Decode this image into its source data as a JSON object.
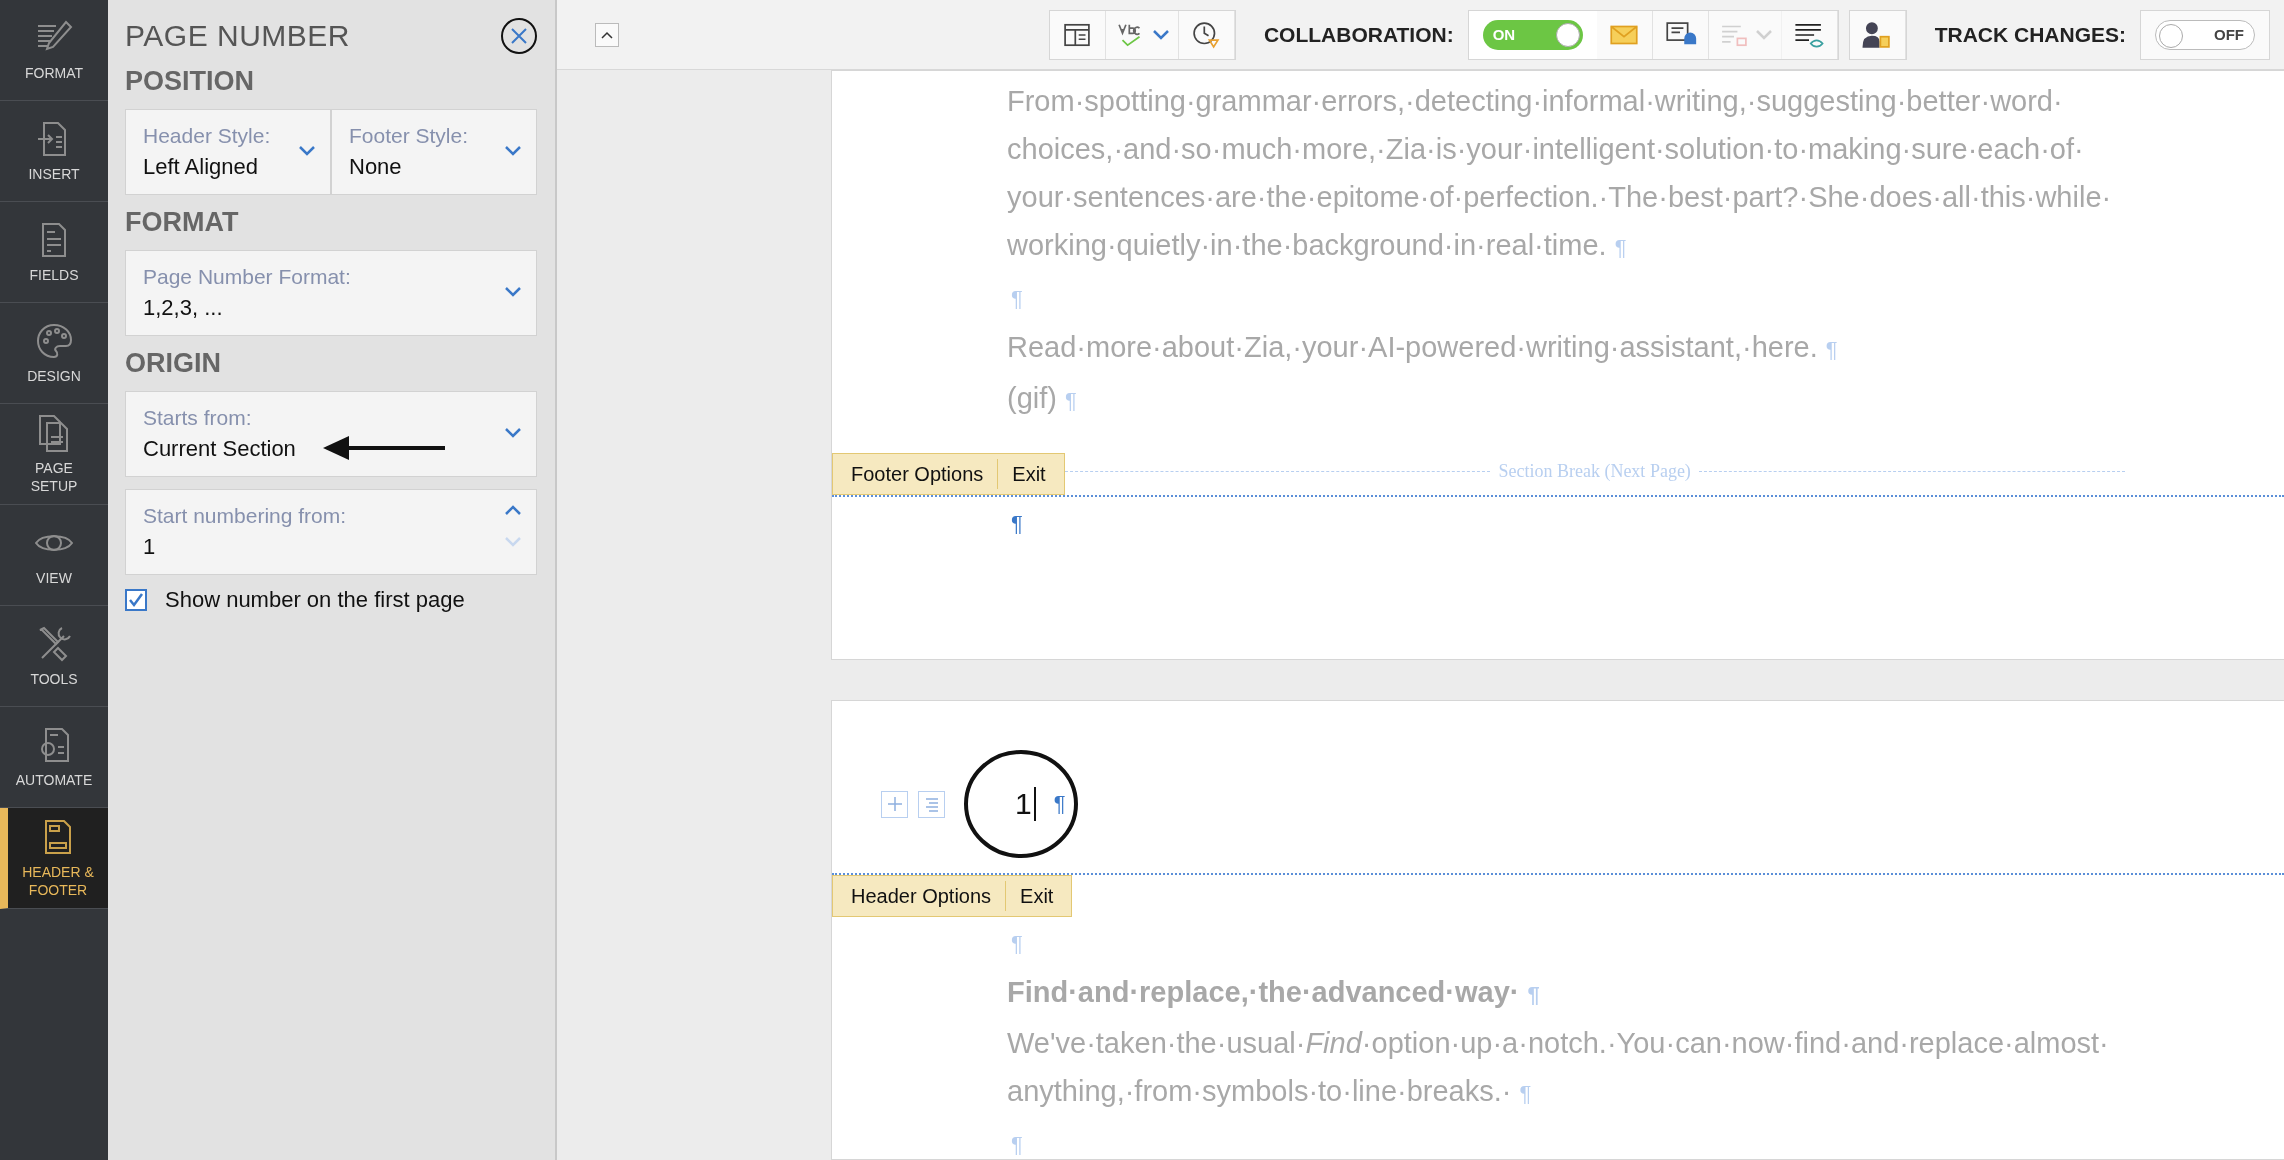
{
  "sidebar": {
    "items": [
      {
        "label": "FORMAT",
        "selected": false
      },
      {
        "label": "INSERT",
        "selected": false
      },
      {
        "label": "FIELDS",
        "selected": false
      },
      {
        "label": "DESIGN",
        "selected": false
      },
      {
        "label": "PAGE SETUP",
        "selected": false
      },
      {
        "label": "VIEW",
        "selected": false
      },
      {
        "label": "TOOLS",
        "selected": false
      },
      {
        "label": "AUTOMATE",
        "selected": false
      },
      {
        "label": "HEADER & FOOTER",
        "selected": true
      }
    ]
  },
  "panel": {
    "title": "PAGE NUMBER",
    "sections": [
      {
        "heading": "POSITION",
        "fields": [
          {
            "kind": "dropdown",
            "label": "Header Style:",
            "value": "Left Aligned"
          },
          {
            "kind": "dropdown",
            "label": "Footer Style:",
            "value": "None"
          }
        ]
      },
      {
        "heading": "FORMAT",
        "fields": [
          {
            "kind": "dropdown",
            "label": "Page Number Format:",
            "value": "1,2,3, ..."
          }
        ]
      },
      {
        "heading": "ORIGIN",
        "fields": [
          {
            "kind": "dropdown",
            "label": "Starts from:",
            "value": "Current Section"
          },
          {
            "kind": "spinner",
            "label": "Start numbering from:",
            "value": "1"
          }
        ]
      }
    ],
    "checkbox": {
      "label": "Show number on the first page",
      "checked": true
    }
  },
  "toolbar": {
    "view_buttons": [
      {
        "disabled": false
      },
      {
        "disabled": false
      },
      {
        "disabled": false
      }
    ],
    "collaboration": {
      "label": "COLLABORATION:",
      "on": true,
      "state": "ON"
    },
    "collab_buttons": [
      {
        "disabled": false
      },
      {
        "disabled": false
      },
      {
        "disabled": true
      },
      {
        "disabled": false
      }
    ],
    "track_changes": {
      "label": "TRACK CHANGES:",
      "on": false,
      "state": "OFF"
    }
  },
  "document": {
    "page_1": {
      "paragraphs": [
        {
          "kind": "body",
          "text": "From·spotting·grammar·errors,·detecting·informal·writing,·suggesting·better·word·choices,·and·so·much·more,·Zia·is·your·intelligent·solution·to·making·sure·each·of·your·sentences·are·the·epitome·of·perfection.·The·best·part?·She·does·all·this·while·working·quietly·in·the·background·in·real·time.",
          "mark": "¶"
        },
        {
          "mark": "¶"
        },
        {
          "kind": "body",
          "text": "Read·more·about·Zia,·your·AI-powered·writing·assistant,·here.",
          "mark": "¶"
        },
        {
          "kind": "body",
          "text": "(gif)",
          "mark": "¶"
        }
      ],
      "footer_bar": {
        "options": "Footer Options",
        "exit": "Exit"
      },
      "section_break": "Section Break (Next Page)",
      "footer_paragraphs": [
        {
          "mark": "¶"
        }
      ]
    },
    "page_2": {
      "header": {
        "text": "1",
        "mark": "¶"
      },
      "header_bar": {
        "options": "Header Options",
        "exit": "Exit"
      },
      "paragraphs": [
        {
          "mark": "¶"
        },
        {
          "kind": "heading",
          "text": "Find·and·replace,·the·advanced·way·",
          "mark": "¶"
        },
        {
          "kind": "body",
          "text": "We've·taken·the·usual·*Find*·option·up·a·notch.·You·can·now·find·and·replace·almost·anything,·from·symbols·to·line·breaks.·",
          "mark": "¶"
        },
        {
          "mark": "¶"
        }
      ]
    }
  }
}
